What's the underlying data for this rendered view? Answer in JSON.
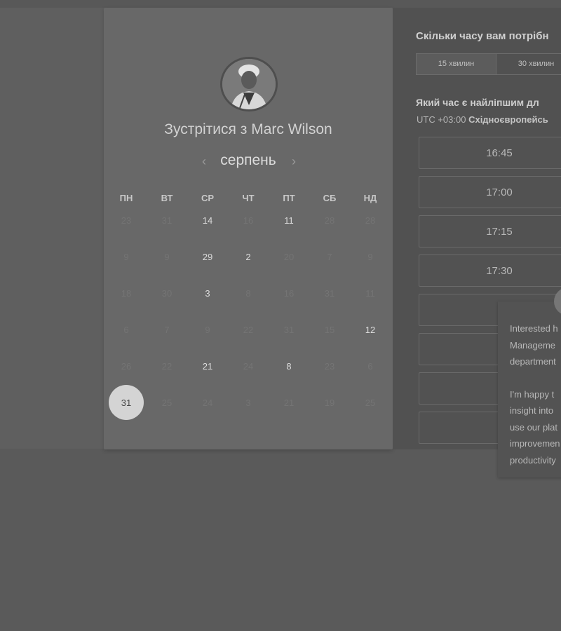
{
  "scheduler": {
    "title": "Зустрітися з Marc Wilson",
    "month": "серпень",
    "prev_icon": "‹",
    "next_icon": "›",
    "weekdays": [
      "ПН",
      "ВТ",
      "СР",
      "ЧТ",
      "ПТ",
      "СБ",
      "НД"
    ],
    "weeks": [
      [
        {
          "d": "23",
          "a": false
        },
        {
          "d": "31",
          "a": false
        },
        {
          "d": "14",
          "a": true
        },
        {
          "d": "16",
          "a": false
        },
        {
          "d": "11",
          "a": true
        },
        {
          "d": "28",
          "a": false
        },
        {
          "d": "28",
          "a": false
        }
      ],
      [
        {
          "d": "9",
          "a": false
        },
        {
          "d": "9",
          "a": false
        },
        {
          "d": "29",
          "a": true
        },
        {
          "d": "2",
          "a": true
        },
        {
          "d": "20",
          "a": false
        },
        {
          "d": "7",
          "a": false
        },
        {
          "d": "9",
          "a": false
        }
      ],
      [
        {
          "d": "18",
          "a": false
        },
        {
          "d": "30",
          "a": false
        },
        {
          "d": "3",
          "a": true
        },
        {
          "d": "8",
          "a": false
        },
        {
          "d": "16",
          "a": false
        },
        {
          "d": "31",
          "a": false
        },
        {
          "d": "11",
          "a": false
        }
      ],
      [
        {
          "d": "6",
          "a": false
        },
        {
          "d": "7",
          "a": false
        },
        {
          "d": "9",
          "a": false
        },
        {
          "d": "22",
          "a": false
        },
        {
          "d": "31",
          "a": false
        },
        {
          "d": "15",
          "a": false
        },
        {
          "d": "12",
          "a": true
        }
      ],
      [
        {
          "d": "26",
          "a": false
        },
        {
          "d": "22",
          "a": false
        },
        {
          "d": "21",
          "a": true
        },
        {
          "d": "24",
          "a": false
        },
        {
          "d": "8",
          "a": true
        },
        {
          "d": "23",
          "a": false
        },
        {
          "d": "6",
          "a": false
        }
      ],
      [
        {
          "d": "31",
          "a": true,
          "s": true
        },
        {
          "d": "25",
          "a": false
        },
        {
          "d": "24",
          "a": false
        },
        {
          "d": "3",
          "a": false
        },
        {
          "d": "21",
          "a": false
        },
        {
          "d": "19",
          "a": false
        },
        {
          "d": "25",
          "a": false
        }
      ]
    ]
  },
  "booking": {
    "duration_question": "Скільки часу вам потрібн",
    "durations": [
      "15 хвилин",
      "30 хвилин"
    ],
    "time_question": "Який час є найліпшим дл",
    "timezone_offset": "UTC +03:00",
    "timezone_name": "Східноєвропейсь",
    "slots": [
      "16:45",
      "17:00",
      "17:15",
      "17:30",
      "",
      "",
      "",
      ""
    ]
  },
  "popup": {
    "paragraph1": [
      "Interested h",
      "Manageme",
      "department"
    ],
    "paragraph2": [
      "I'm happy t",
      "insight into",
      "use our plat",
      "improvemen",
      "productivity"
    ]
  }
}
